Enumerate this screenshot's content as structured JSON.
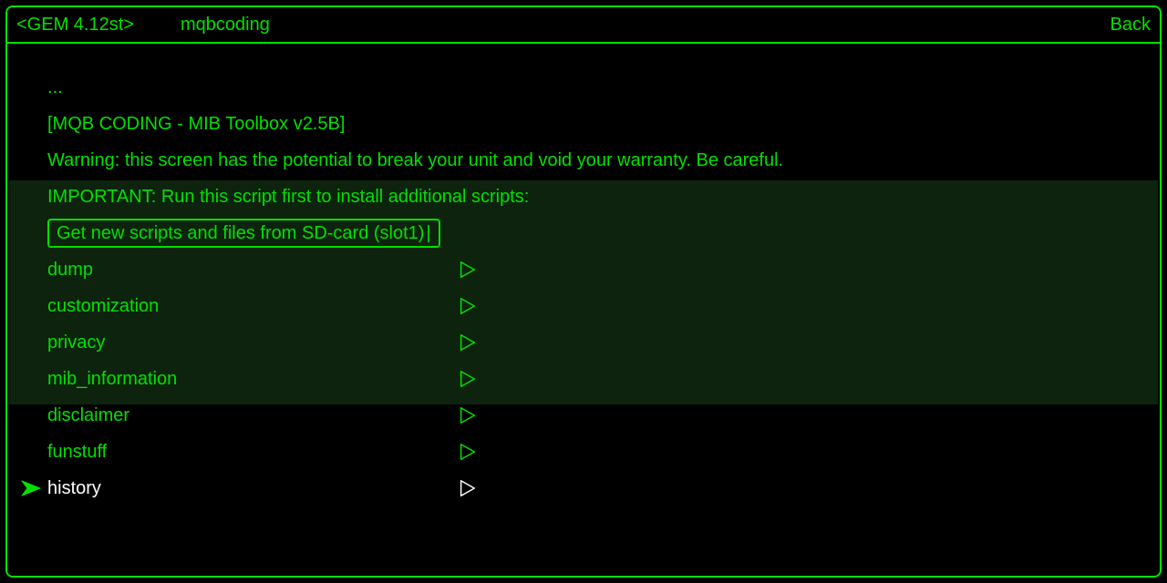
{
  "header": {
    "title": "<GEM 4.12st>",
    "sub": "mqbcoding",
    "back": "Back"
  },
  "lines": {
    "ellipsis": "...",
    "banner": "[MQB CODING - MIB Toolbox v2.5B]",
    "warning": "Warning: this screen has the potential to break your unit and void your warranty. Be careful.",
    "important": "IMPORTANT: Run this script first to install additional scripts:",
    "boxed": "Get new scripts and files from SD-card (slot1)"
  },
  "menu": [
    {
      "label": "dump"
    },
    {
      "label": "customization"
    },
    {
      "label": "privacy"
    },
    {
      "label": "mib_information"
    },
    {
      "label": "disclaimer"
    },
    {
      "label": "funstuff"
    },
    {
      "label": "history",
      "selected": true
    }
  ],
  "colors": {
    "green": "#00e000",
    "bg": "#000000",
    "band": "#0d230d",
    "selected_text": "#ffffff"
  }
}
